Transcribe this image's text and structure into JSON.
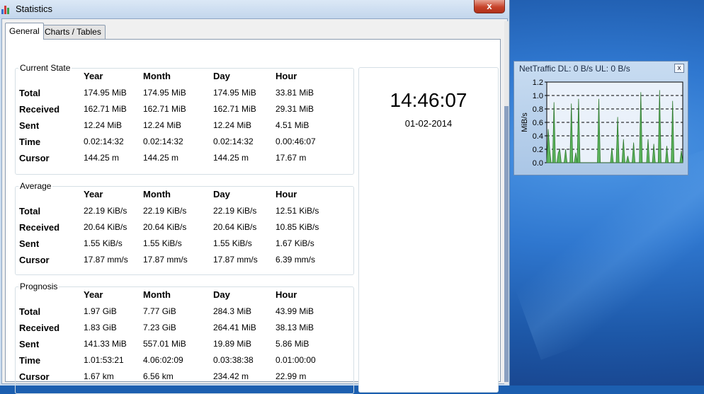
{
  "window": {
    "title": "Statistics",
    "close_glyph": "x"
  },
  "tabs": [
    {
      "label": "General",
      "active": true
    },
    {
      "label": "Charts / Tables",
      "active": false
    }
  ],
  "columns": [
    "Year",
    "Month",
    "Day",
    "Hour"
  ],
  "current_state": {
    "title": "Current State",
    "rows": [
      {
        "label": "Total",
        "values": [
          "174.95 MiB",
          "174.95 MiB",
          "174.95 MiB",
          "33.81 MiB"
        ]
      },
      {
        "label": "Received",
        "values": [
          "162.71 MiB",
          "162.71 MiB",
          "162.71 MiB",
          "29.31 MiB"
        ]
      },
      {
        "label": "Sent",
        "values": [
          "12.24 MiB",
          "12.24 MiB",
          "12.24 MiB",
          "4.51 MiB"
        ]
      },
      {
        "label": "Time",
        "values": [
          "0.02:14:32",
          "0.02:14:32",
          "0.02:14:32",
          "0.00:46:07"
        ]
      },
      {
        "label": "Cursor",
        "values": [
          "144.25 m",
          "144.25 m",
          "144.25 m",
          "17.67 m"
        ]
      }
    ]
  },
  "average": {
    "title": "Average",
    "rows": [
      {
        "label": "Total",
        "values": [
          "22.19 KiB/s",
          "22.19 KiB/s",
          "22.19 KiB/s",
          "12.51 KiB/s"
        ]
      },
      {
        "label": "Received",
        "values": [
          "20.64 KiB/s",
          "20.64 KiB/s",
          "20.64 KiB/s",
          "10.85 KiB/s"
        ]
      },
      {
        "label": "Sent",
        "values": [
          "1.55 KiB/s",
          "1.55 KiB/s",
          "1.55 KiB/s",
          "1.67 KiB/s"
        ]
      },
      {
        "label": "Cursor",
        "values": [
          "17.87 mm/s",
          "17.87 mm/s",
          "17.87 mm/s",
          "6.39 mm/s"
        ]
      }
    ]
  },
  "prognosis": {
    "title": "Prognosis",
    "rows": [
      {
        "label": "Total",
        "values": [
          "1.97 GiB",
          "7.77 GiB",
          "284.3 MiB",
          "43.99 MiB"
        ]
      },
      {
        "label": "Received",
        "values": [
          "1.83 GiB",
          "7.23 GiB",
          "264.41 MiB",
          "38.13 MiB"
        ]
      },
      {
        "label": "Sent",
        "values": [
          "141.33 MiB",
          "557.01 MiB",
          "19.89 MiB",
          "5.86 MiB"
        ]
      },
      {
        "label": "Time",
        "values": [
          "1.01:53:21",
          "4.06:02:09",
          "0.03:38:38",
          "0.01:00:00"
        ]
      },
      {
        "label": "Cursor",
        "values": [
          "1.67 km",
          "6.56 km",
          "234.42 m",
          "22.99 m"
        ]
      }
    ]
  },
  "clock": {
    "time": "14:46:07",
    "date": "01-02-2014"
  },
  "gadget": {
    "title": "NetTraffic DL: 0 B/s UL: 0 B/s",
    "close_glyph": "x",
    "chart_data": {
      "type": "area",
      "ylabel": "MiB/s",
      "ylim": [
        0,
        1.2
      ],
      "yticks": [
        "0.0",
        "0.2",
        "0.4",
        "0.6",
        "0.8",
        "1.0",
        "1.2"
      ],
      "grid": true,
      "color": "#5db55d",
      "values": [
        0,
        0.5,
        0.2,
        0,
        0,
        0.9,
        0,
        0,
        0.15,
        0.2,
        0,
        0,
        0,
        0.2,
        0,
        0,
        0,
        0.88,
        0,
        0,
        0.15,
        0,
        0.95,
        0,
        0,
        0,
        0,
        0,
        0,
        0,
        0,
        0,
        0,
        0,
        0,
        0,
        0.95,
        0,
        0,
        0,
        0,
        0,
        0,
        0,
        0,
        0.22,
        0,
        0,
        0,
        0.68,
        0,
        0,
        0,
        0.35,
        0,
        0,
        0.1,
        0,
        0,
        0,
        0.3,
        0,
        0,
        0,
        0,
        1.05,
        0,
        0,
        0,
        0,
        0.35,
        0,
        0,
        0,
        0.28,
        0,
        0,
        0,
        1.08,
        0,
        0,
        0,
        0,
        0.25,
        0,
        0,
        0,
        0.92,
        0,
        0,
        0,
        0,
        0,
        0.18,
        0
      ]
    }
  }
}
